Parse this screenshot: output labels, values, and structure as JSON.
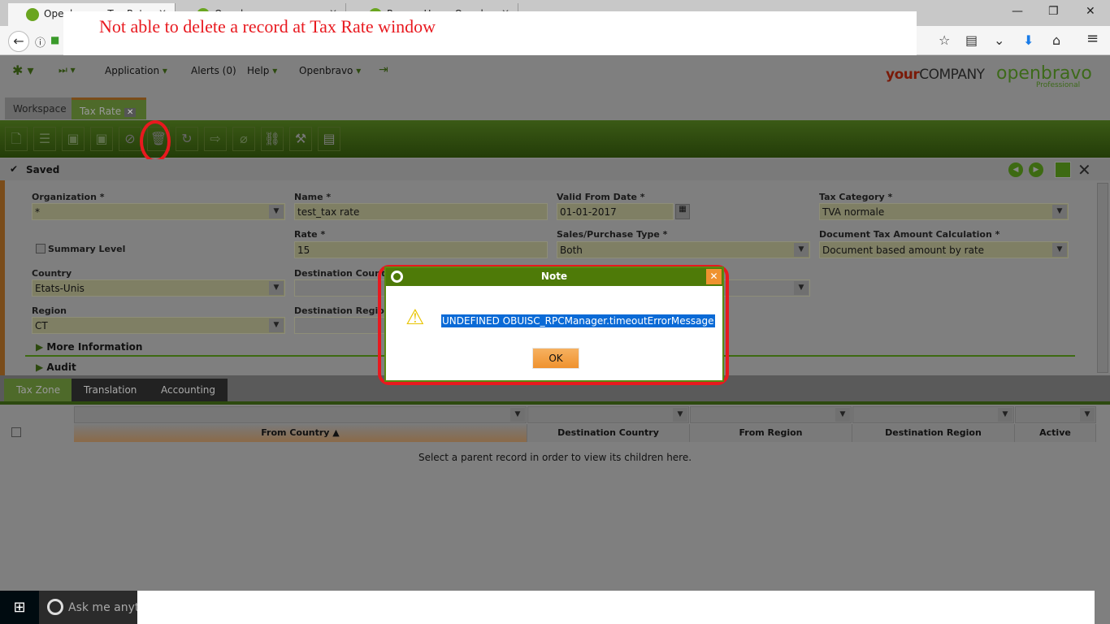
{
  "browser": {
    "tabs": [
      "Openbravo - Tax Rate",
      "Openbravo",
      "ProcessHeavyOpenbravo"
    ],
    "toolbar_icons": [
      "back-icon",
      "info-icon",
      "lock-icon",
      "star-icon",
      "reading-list-icon",
      "pocket-icon",
      "download-icon",
      "home-icon",
      "menu-icon"
    ]
  },
  "annotation": "Not able to delete a record at Tax Rate window",
  "appnav": {
    "application": "Application",
    "alerts": "Alerts (0)",
    "help": "Help",
    "openbravo": "Openbravo"
  },
  "branding": {
    "company_a": "your",
    "company_b": "COMPANY",
    "product": "openbravo",
    "edition": "Professional"
  },
  "main_tabs": {
    "workspace": "Workspace",
    "tax_rate": "Tax Rate"
  },
  "status": "Saved",
  "form": {
    "organization": {
      "label": "Organization *",
      "value": "*"
    },
    "name": {
      "label": "Name *",
      "value": "test_tax rate"
    },
    "valid_from": {
      "label": "Valid From Date *",
      "value": "01-01-2017"
    },
    "tax_category": {
      "label": "Tax Category *",
      "value": "TVA normale"
    },
    "summary_level": "Summary Level",
    "rate": {
      "label": "Rate *",
      "value": "15"
    },
    "sales_purchase": {
      "label": "Sales/Purchase Type *",
      "value": "Both"
    },
    "doc_tax_calc": {
      "label": "Document Tax Amount Calculation *",
      "value": "Document based amount by rate"
    },
    "country": {
      "label": "Country",
      "value": "Etats-Unis"
    },
    "dest_country": {
      "label": "Destination Country",
      "value": ""
    },
    "region": {
      "label": "Region",
      "value": "CT"
    },
    "dest_region": {
      "label": "Destination Region",
      "value": ""
    },
    "more_info": "More Information",
    "audit": "Audit"
  },
  "sub_tabs": [
    "Tax Zone",
    "Translation",
    "Accounting"
  ],
  "grid": {
    "columns": [
      "From Country ▲",
      "Destination Country",
      "From Region",
      "Destination Region",
      "Active"
    ],
    "empty_message": "Select a parent record in order to view its children here."
  },
  "dialog": {
    "title": "Note",
    "message": "UNDEFINED OBUISC_RPCManager.timeoutErrorMessage",
    "ok": "OK"
  },
  "taskbar": {
    "search": "Ask me anything"
  }
}
